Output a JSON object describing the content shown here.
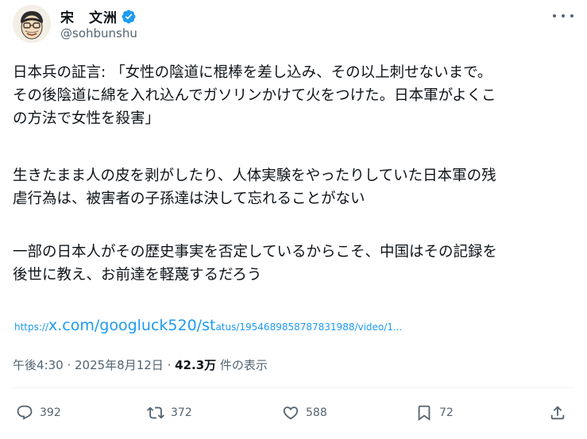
{
  "author": {
    "display_name": "宋　文洲",
    "handle": "@sohbunshu",
    "verified_icon": "verified-badge-icon",
    "avatar": "avatar-illustration"
  },
  "post": {
    "paragraph_1": [
      "日本兵の証言: 「女性の陰道に棍棒を差し込み、その以上刺せないまで。",
      "その後陰道に綿を入れ込んでガソリンかけて火をつけた。日本軍がよくこ",
      "の方法で女性を殺害」"
    ],
    "paragraph_2": [
      "生きたまま人の皮を剥がしたり、人体実験をやったりしていた日本軍の残",
      "虐行為は、被害者の子孫達は決して忘れることがない"
    ],
    "paragraph_3": [
      "一部の日本人がその歴史事実を否定しているからこそ、中国はその記録を",
      "後世に教え、お前達を軽蔑するだろう"
    ],
    "link": {
      "proto": "https://",
      "domain": "x.com/googluck520/st",
      "rest": "atus/1954689858787831988/video/1..."
    }
  },
  "meta": {
    "time": "午後4:30",
    "sep": " · ",
    "date": "2025年8月12日",
    "views_count": "42.3万",
    "views_label": " 件の表示"
  },
  "actions": {
    "replies": "392",
    "retweets": "372",
    "likes": "588",
    "bookmarks": "72"
  },
  "colors": {
    "accent": "#1d9bf0",
    "secondary_text": "#536471",
    "primary_text": "#0f1419",
    "divider": "#eff3f4"
  }
}
